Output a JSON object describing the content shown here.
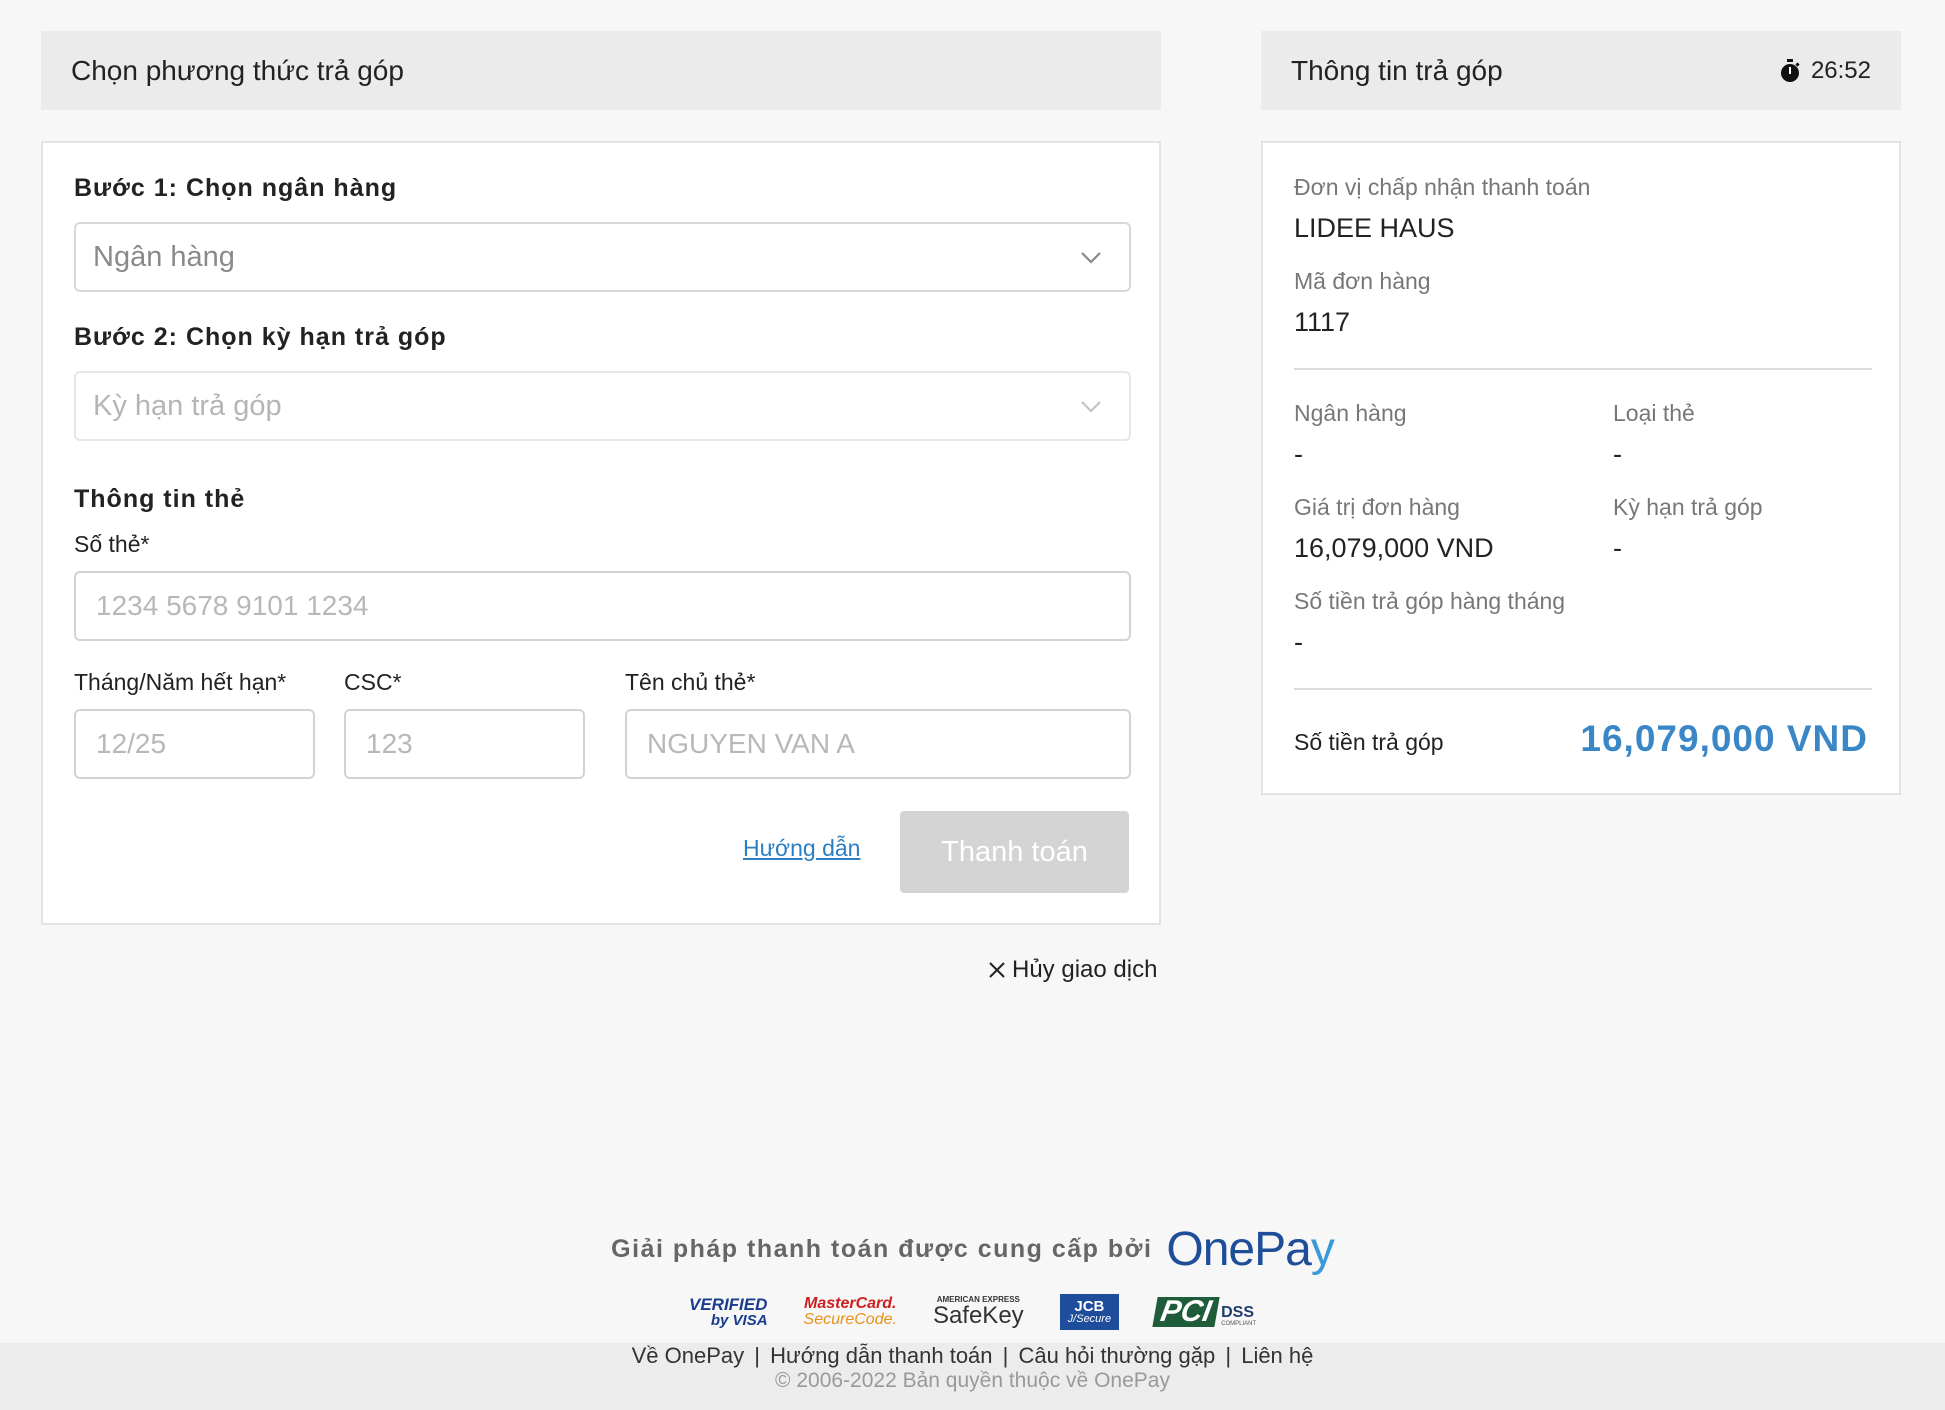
{
  "left_header": {
    "title": "Chọn phương thức trả góp"
  },
  "right_header": {
    "title": "Thông tin trả góp",
    "timer": "26:52"
  },
  "form": {
    "step1_label": "Bước 1: Chọn ngân hàng",
    "bank_placeholder": "Ngân hàng",
    "step2_label": "Bước 2: Chọn kỳ hạn trả góp",
    "term_placeholder": "Kỳ hạn trả góp",
    "card_info_label": "Thông tin thẻ",
    "card_number_label": "Số thẻ*",
    "card_number_placeholder": "1234 5678 9101 1234",
    "expiry_label": "Tháng/Năm hết hạn*",
    "expiry_placeholder": "12/25",
    "csc_label": "CSC*",
    "csc_placeholder": "123",
    "holder_label": "Tên chủ thẻ*",
    "holder_placeholder": "NGUYEN VAN A",
    "guide_link": "Hướng dẫn",
    "pay_button": "Thanh toán"
  },
  "info": {
    "merchant_label": "Đơn vị chấp nhận thanh toán",
    "merchant_value": "LIDEE HAUS",
    "order_id_label": "Mã đơn hàng",
    "order_id_value": "1117",
    "bank_label": "Ngân hàng",
    "bank_value": "-",
    "card_type_label": "Loại thẻ",
    "card_type_value": "-",
    "order_value_label": "Giá trị đơn hàng",
    "order_value_value": "16,079,000 VND",
    "term_label": "Kỳ hạn trả góp",
    "term_value": "-",
    "monthly_label": "Số tiền trả góp hàng tháng",
    "monthly_value": "-",
    "total_label": "Số tiền trả góp",
    "total_value": "16,079,000 VND"
  },
  "cancel": {
    "label": "Hủy giao dịch"
  },
  "footer": {
    "powered_by": "Giải pháp thanh toán được cung cấp bởi",
    "brand_one": "One",
    "brand_pa": "Pa",
    "brand_y": "y",
    "badges": {
      "visa_1": "VERIFIED",
      "visa_2": "by VISA",
      "mc_1": "MasterCard.",
      "mc_2": "SecureCode.",
      "amex_1": "AMERICAN EXPRESS",
      "amex_2": "SafeKey",
      "jcb_1": "JCB",
      "jcb_2": "J/Secure",
      "pci_1": "PCI",
      "pci_2": "DSS",
      "pci_3": "COMPLIANT"
    },
    "links": [
      "Về OnePay",
      "Hướng dẫn thanh toán",
      "Câu hỏi thường gặp",
      "Liên hệ"
    ],
    "separator": "|",
    "copyright": "© 2006-2022 Bản quyền thuộc về OnePay"
  },
  "colors": {
    "accent": "#3a87c8",
    "brand": "#1f4e99",
    "disabled_button": "#d4d4d4"
  }
}
